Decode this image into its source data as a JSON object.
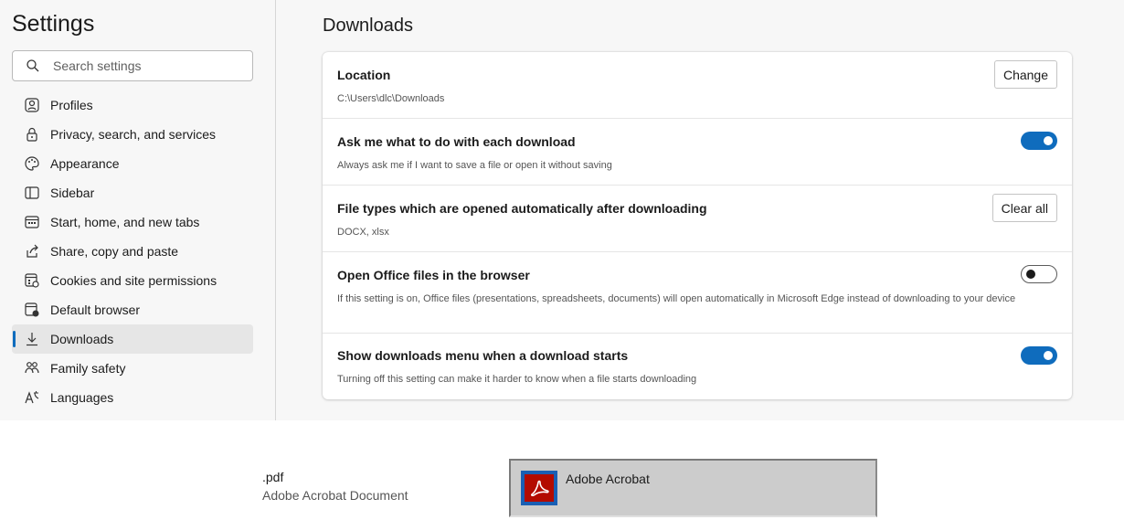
{
  "sidebar": {
    "title": "Settings",
    "search_placeholder": "Search settings",
    "items": [
      {
        "label": "Profiles",
        "icon": "profile-icon"
      },
      {
        "label": "Privacy, search, and services",
        "icon": "lock-icon"
      },
      {
        "label": "Appearance",
        "icon": "palette-icon"
      },
      {
        "label": "Sidebar",
        "icon": "sidebar-icon"
      },
      {
        "label": "Start, home, and new tabs",
        "icon": "home-tabs-icon"
      },
      {
        "label": "Share, copy and paste",
        "icon": "share-icon"
      },
      {
        "label": "Cookies and site permissions",
        "icon": "cookies-icon"
      },
      {
        "label": "Default browser",
        "icon": "browser-icon"
      },
      {
        "label": "Downloads",
        "icon": "download-icon",
        "active": true
      },
      {
        "label": "Family safety",
        "icon": "family-icon"
      },
      {
        "label": "Languages",
        "icon": "language-icon"
      }
    ]
  },
  "main": {
    "title": "Downloads",
    "location": {
      "title": "Location",
      "value": "C:\\Users\\dlc\\Downloads",
      "button": "Change"
    },
    "ask": {
      "title": "Ask me what to do with each download",
      "sub": "Always ask me if I want to save a file or open it without saving",
      "toggle": "on"
    },
    "filetypes": {
      "title": "File types which are opened automatically after downloading",
      "value": "DOCX, xlsx",
      "button": "Clear all"
    },
    "office": {
      "title": "Open Office files in the browser",
      "sub": "If this setting is on, Office files (presentations, spreadsheets, documents) will open automatically in Microsoft Edge instead of downloading to your device",
      "toggle": "off"
    },
    "menu": {
      "title": "Show downloads menu when a download starts",
      "sub": "Turning off this setting can make it harder to know when a file starts downloading",
      "toggle": "on"
    }
  },
  "association": {
    "extension": ".pdf",
    "description": "Adobe Acrobat Document",
    "app": "Adobe Acrobat",
    "app_icon": "adobe-acrobat-icon"
  },
  "colors": {
    "accent": "#0f6cbd",
    "acrobat_red": "#b30b00"
  }
}
